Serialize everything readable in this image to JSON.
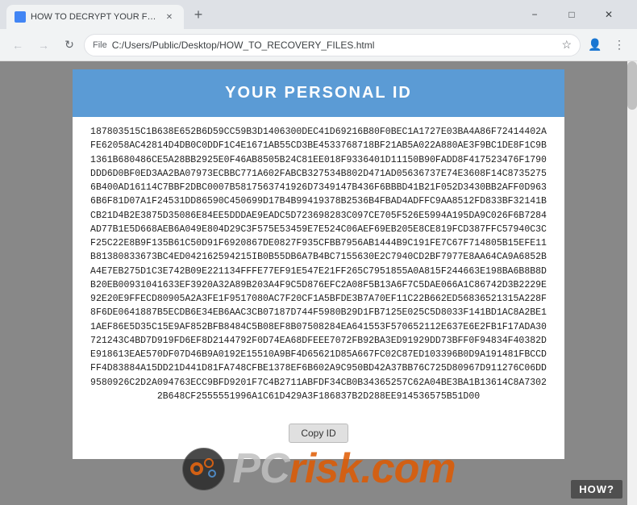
{
  "browser": {
    "tab_title": "HOW TO DECRYPT YOUR FILES",
    "tab_favicon": "page-icon",
    "new_tab_label": "+",
    "window_minimize": "−",
    "window_maximize": "□",
    "window_close": "✕",
    "back_btn": "←",
    "forward_btn": "→",
    "refresh_btn": "↻",
    "address_scheme": "File",
    "address_path": "C:/Users/Public/Desktop/HOW_TO_RECOVERY_FILES.html",
    "bookmark_icon": "☆",
    "profile_icon": "👤",
    "menu_icon": "⋮"
  },
  "page": {
    "header_title": "YOUR PERSONAL ID",
    "id_text": "187803515C1B638E652B6D59CC59B3D1406300DEC41D69216B80F0BEC1A1727E03BA4A86F72414402AFE62058AC42814D4DB0C0DDF1C4E1671AB55CD3BE4533768718BF21AB5A022A880AE3F9BC1DE8F1C9B1361B680486CE5A28BB2925E0F46AB8505B24C81EE018F9336401D11150B90FADD8F417523476F1790DDD6D0BF0ED3AA2BA07973ECBBC771A602FABCB327534B802D471AD05636737E74E3608F14C87352756B400AD16114C7BBF2DBC0007B5817563741926D7349147B436F6BBBD41B21F052D3430BB2AFF0D9636B6F81D07A1F24531DD86590C450699D17B4B99419378B2536B4FBAD4ADFFC9AA8512FD833BF32141BCB21D4B2E3875D35086E84EE5DDDAE9EADC5D723698283C097CE705F526E5994A195DA9C026F6B7284AD77B1E5D668AEB6A049E804D29C3F575E53459E7E524C06AEF69EB205E8CE819FCD387FFC57940C3CF25C22E8B9F135B61C50D91F6920867DE0827F935CFBB7956AB1444B9C191FE7C67F714805B15EFE11B81380833673BC4ED042162594215IB0B55DB6A7B4BC7155630E2C7940CD2BF7977E8AA64CA9A6852BA4E7EB275D1C3E742B09E221134FFFE77EF91E547E21FF265C7951855A0A815F244663E198BA6B8B8DB20EB00931041633EF3920A32A89B203A4F9C5D876EFC2A08F5B13A6F7C5DAE066A1C86742D3B2229E92E20E9FFECD80905A2A3FE1F9517080AC7F20CF1A5BFDE3B7A70EF11C22B662ED56836521315A228F8F6DE0641887B5ECDB6E34EB6AAC3CB07187D744F5980B29D1FB7125E025C5D8033F141BD1AC8A2BE11AEF86E5D35C15E9AF852BFB8484C5B08EF8B07508284EA641553F570652112E637E6E2FB1F17ADA30721243C4BD7D919FD6EF8D2144792F0D74EA68DFEEE7072FB92BA3ED91929DD73BFF0F94834F40382DE918613EAE570DF07D46B9A0192E15510A9BF4D65621D85A667FC02C87ED103396B0D9A191481FBCCDFF4D83884A15DD21D441D81FA748CFBE1378EF6B602A9C950BD42A37BB76C725D80967D911276C06DD9580926C2D2A094763ECC9BFD9201F7C4B2711ABFDF34CB0B34365257C62A04BE3BA1B13614C8A73022B648CF2555551996A1C61D429A3F186837B2D288EE914536575B51D00",
    "copy_id_btn": "Copy ID"
  },
  "watermark": {
    "text_pc": "PC",
    "text_risk": "risk",
    "text_dot": ".",
    "text_com": "com",
    "how_label": "HOW?"
  }
}
